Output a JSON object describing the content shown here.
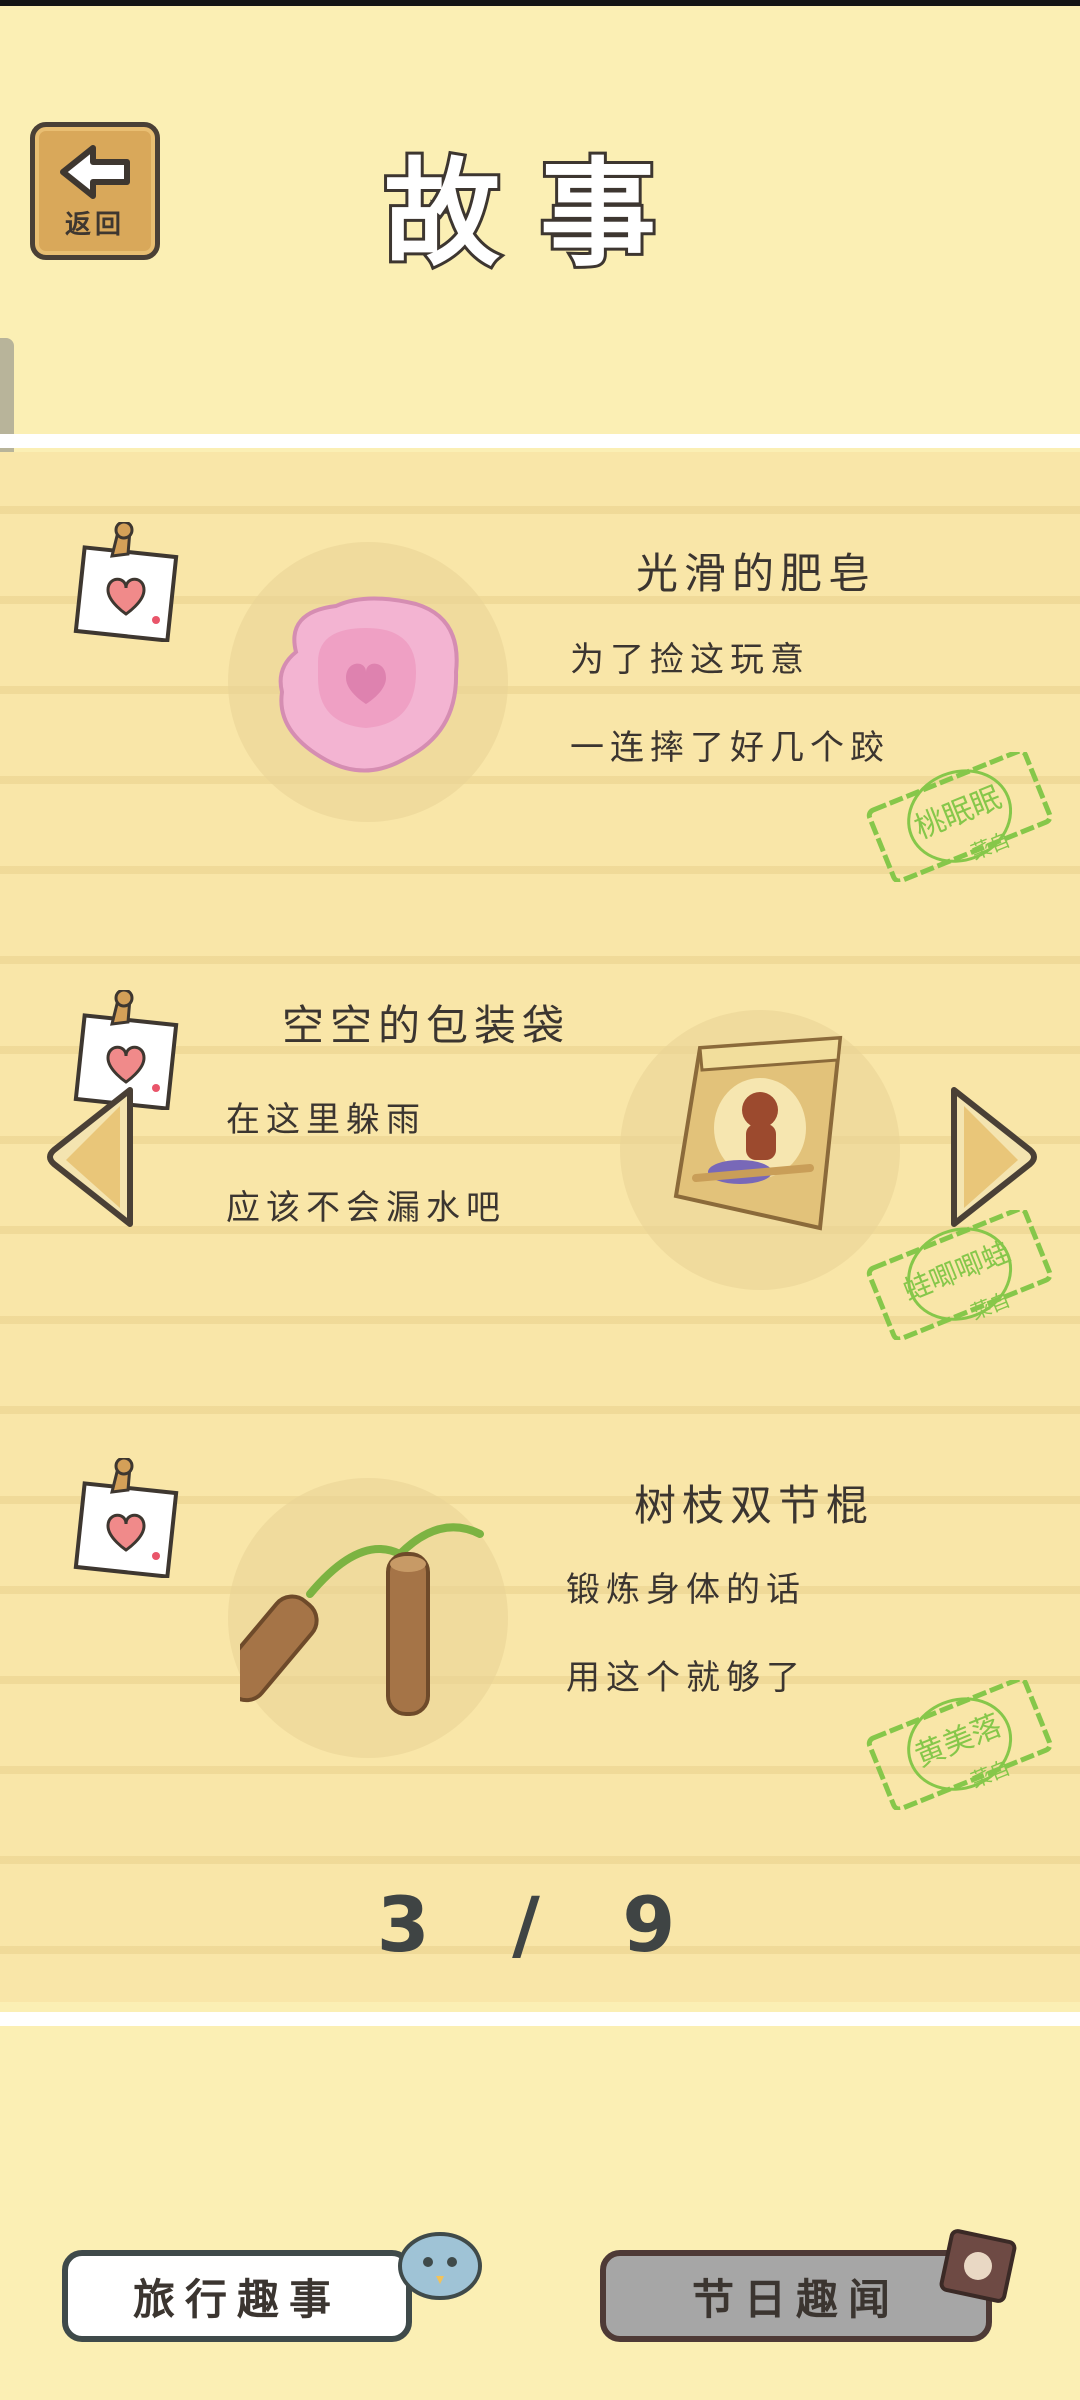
{
  "header": {
    "back_label": "返回",
    "title": "故事"
  },
  "stories": [
    {
      "title": "光滑的肥皂",
      "lines": [
        "为了捡这玩意",
        "一连摔了好几个跤"
      ],
      "stamp_name": "桃眠眠",
      "stamp_sub": "菜自"
    },
    {
      "title": "空空的包装袋",
      "lines": [
        "在这里躲雨",
        "应该不会漏水吧"
      ],
      "stamp_name": "蛙唧唧蛙",
      "stamp_sub": "菜自"
    },
    {
      "title": "树枝双节棍",
      "lines": [
        "锻炼身体的话",
        "用这个就够了"
      ],
      "stamp_name": "黄美落",
      "stamp_sub": "菜自"
    }
  ],
  "pager": {
    "text": "3 / 9"
  },
  "tabs": {
    "travel": "旅行趣事",
    "festival": "节日趣闻"
  },
  "icons": {
    "back": "back-arrow-icon",
    "pin": "pushpin-heart-icon",
    "prev": "left-arrow-icon",
    "next": "right-arrow-icon"
  },
  "colors": {
    "background": "#FBEFB4",
    "stamp_green": "#86C74A",
    "title_outline": "#3D3630"
  }
}
